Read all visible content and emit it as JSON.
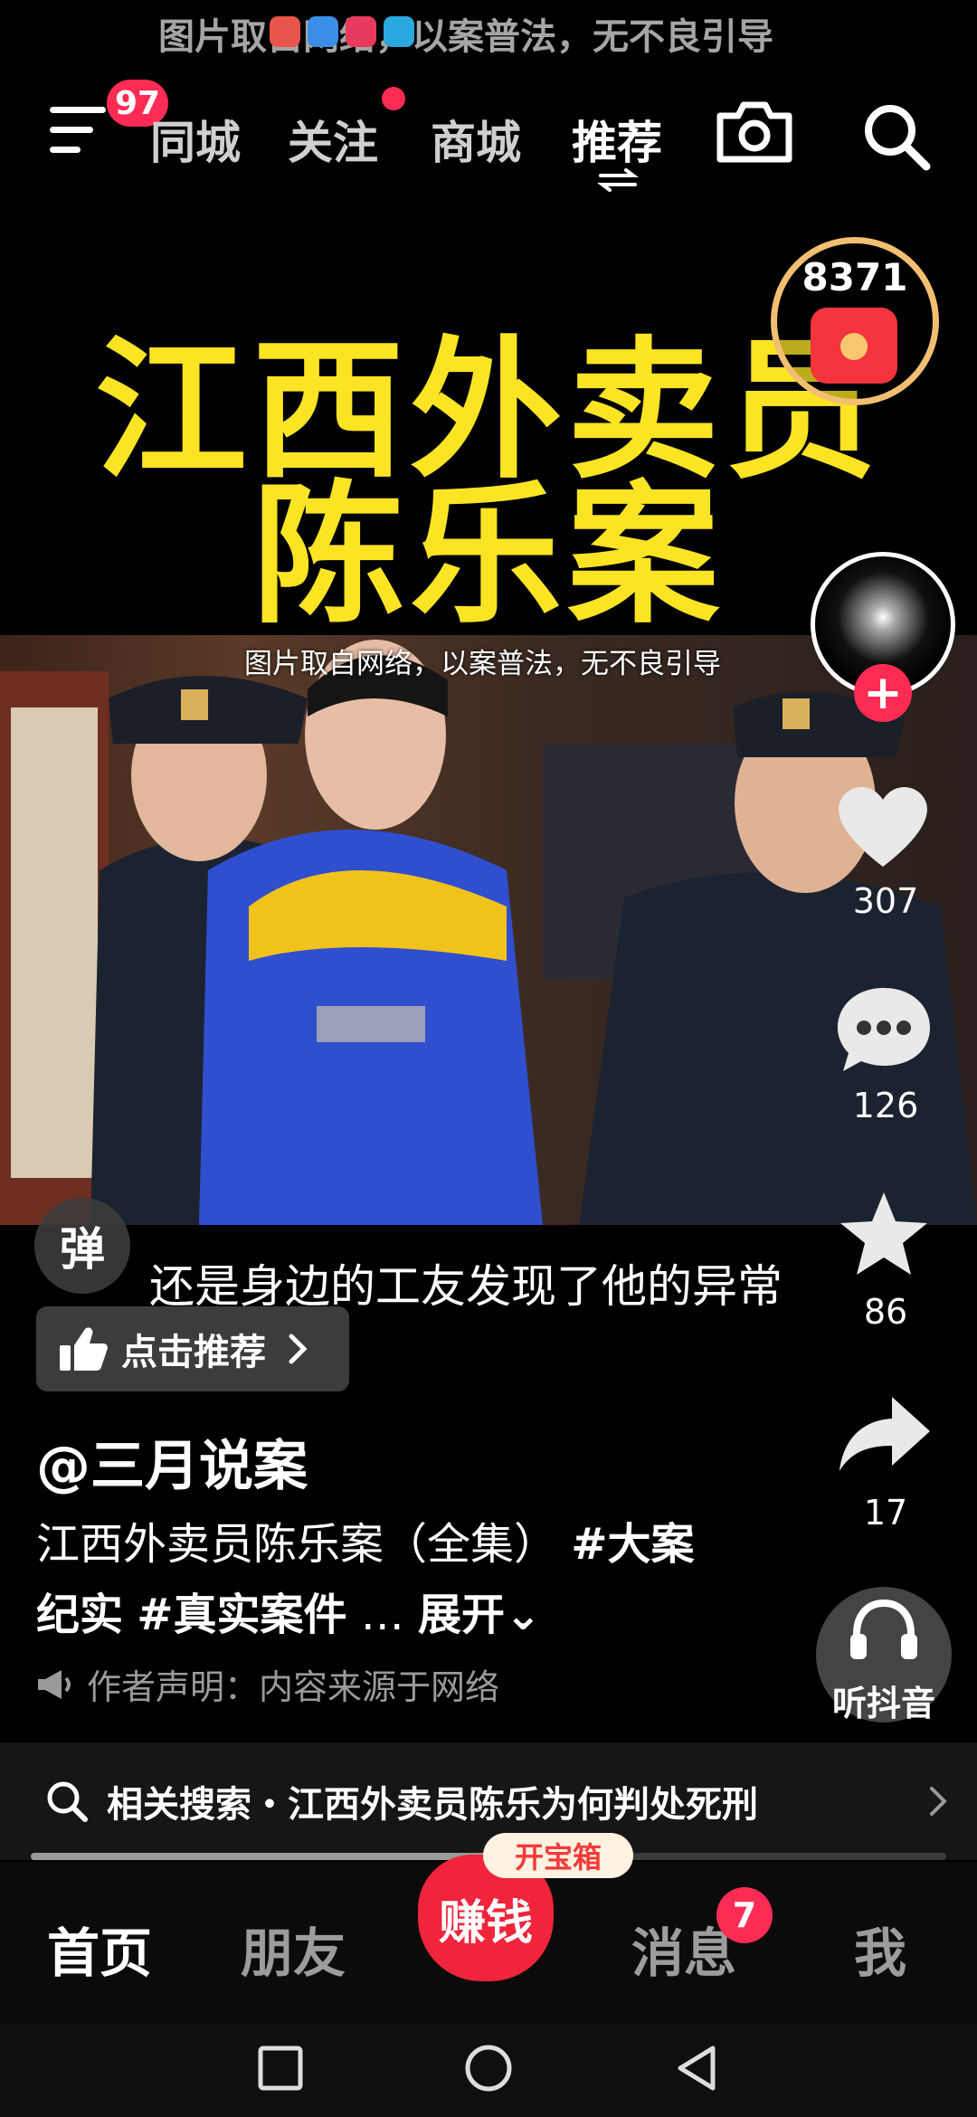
{
  "status_bar": {
    "overlay_text": "图片取自网络，以案普法，无不良引导"
  },
  "top_nav": {
    "menu_badge": "97",
    "tabs": [
      {
        "label": "同城",
        "active": false
      },
      {
        "label": "关注",
        "active": false,
        "dot": true
      },
      {
        "label": "商城",
        "active": false
      },
      {
        "label": "推荐",
        "active": true
      }
    ]
  },
  "video": {
    "title_line1": "江西外卖员",
    "title_line2": "陈乐案",
    "watermark": "图片取自网络，以案普法，无不良引导",
    "subtitle": "还是身边的工友发现了他的异常"
  },
  "reward": {
    "count": "8371"
  },
  "side": {
    "follow_plus": "+",
    "likes": "307",
    "comments": "126",
    "favorites": "86",
    "shares": "17",
    "listen_label": "听抖音"
  },
  "caption": {
    "danmu": "弹",
    "recommend_label": "点击推荐",
    "author": "@三月说案",
    "desc_text": "江西外卖员陈乐案（全集）",
    "tag1": "#大案纪实",
    "tag2": "#真实案件",
    "ellipsis": "…",
    "expand": "展开",
    "declaration": "作者声明：内容来源于网络"
  },
  "related_search": {
    "text": "相关搜索・江西外卖员陈乐为何判处死刑"
  },
  "progress": {
    "fraction": 0.58
  },
  "bottom_nav": {
    "home": "首页",
    "friends": "朋友",
    "earn": "赚钱",
    "treasure": "开宝箱",
    "messages": "消息",
    "messages_badge": "7",
    "me": "我"
  },
  "colors": {
    "accent_red": "#fe2c55",
    "title_yellow": "#fbe424",
    "reward_gold": "#f2bf71"
  }
}
